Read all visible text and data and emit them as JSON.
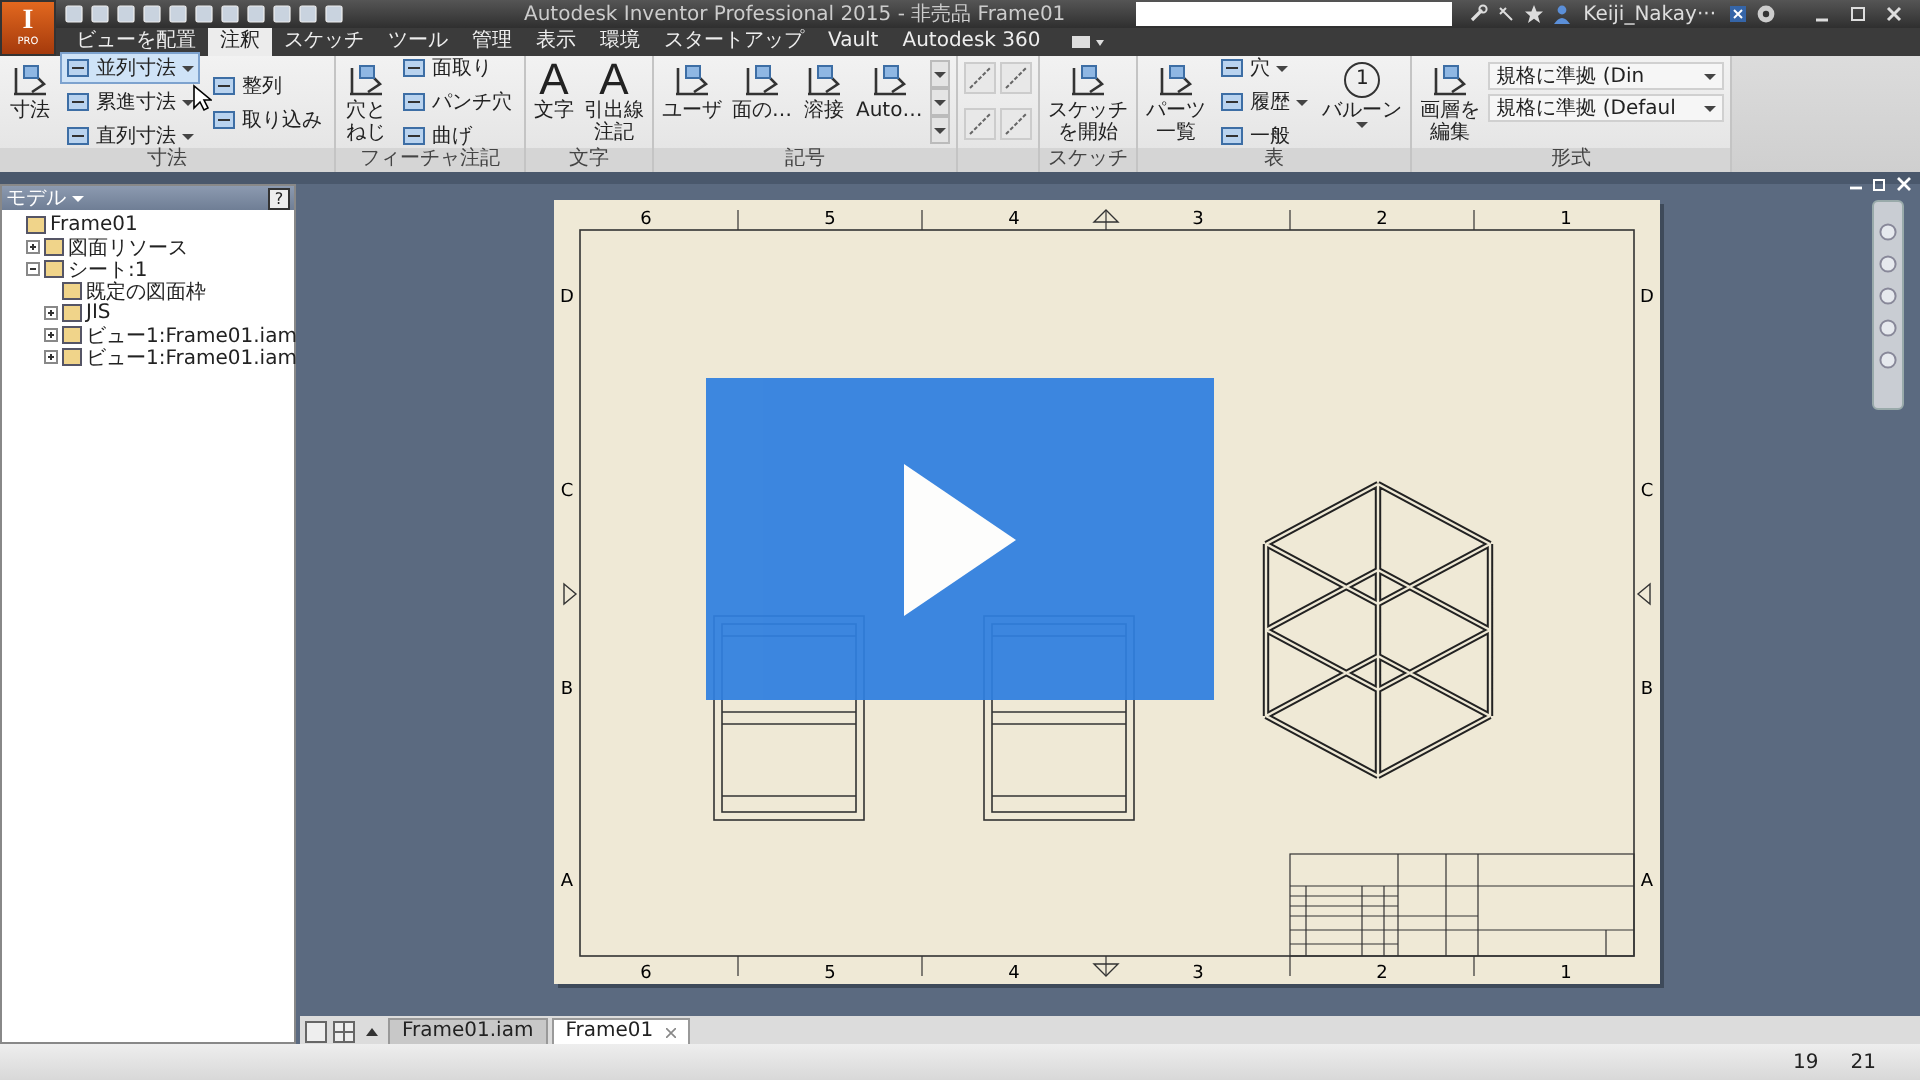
{
  "app_button": {
    "logo": "I",
    "label": "PRO"
  },
  "window": {
    "title": "Autodesk Inventor Professional 2015 - 非売品   Frame01"
  },
  "user": {
    "name": "Keiji_Nakay···"
  },
  "tabs": [
    {
      "label": "ビューを配置",
      "selected": false
    },
    {
      "label": "注釈",
      "selected": true
    },
    {
      "label": "スケッチ",
      "selected": false
    },
    {
      "label": "ツール",
      "selected": false
    },
    {
      "label": "管理",
      "selected": false
    },
    {
      "label": "表示",
      "selected": false
    },
    {
      "label": "環境",
      "selected": false
    },
    {
      "label": "スタートアップ",
      "selected": false
    },
    {
      "label": "Vault",
      "selected": false
    },
    {
      "label": "Autodesk 360",
      "selected": false
    }
  ],
  "ribbon": [
    {
      "title": "寸法",
      "columns": [
        {
          "kind": "large",
          "label": "寸法",
          "dropdown": false
        },
        {
          "kind": "stack",
          "items": [
            {
              "label": "並列寸法",
              "dropdown": true,
              "highlighted": true
            },
            {
              "label": "累進寸法",
              "dropdown": true,
              "highlighted": false
            },
            {
              "label": "直列寸法",
              "dropdown": true,
              "highlighted": false
            }
          ]
        },
        {
          "kind": "stack",
          "items": [
            {
              "label": "整列",
              "dropdown": false,
              "highlighted": false
            },
            {
              "label": "取り込み",
              "dropdown": false,
              "highlighted": false
            }
          ]
        }
      ]
    },
    {
      "title": "フィーチャ注記",
      "columns": [
        {
          "kind": "tall",
          "label": "穴とねじ",
          "dropdown": false
        },
        {
          "kind": "stack",
          "items": [
            {
              "label": "面取り",
              "dropdown": false,
              "highlighted": false
            },
            {
              "label": "パンチ穴",
              "dropdown": false,
              "highlighted": false
            },
            {
              "label": "曲げ",
              "dropdown": false,
              "highlighted": false
            }
          ]
        }
      ]
    },
    {
      "title": "文字",
      "columns": [
        {
          "kind": "large",
          "label": "文字",
          "glyph": "A",
          "dropdown": false
        },
        {
          "kind": "tall",
          "label": "引出線注記",
          "glyph": "A",
          "dropdown": false
        }
      ]
    },
    {
      "title": "記号",
      "columns": [
        {
          "kind": "large",
          "label": "ユーザ",
          "dropdown": false
        },
        {
          "kind": "large",
          "label": "面の…",
          "dropdown": false
        },
        {
          "kind": "large",
          "label": "溶接",
          "dropdown": false
        },
        {
          "kind": "large",
          "label": "Auto…",
          "dropdown": false
        },
        {
          "kind": "gallery_scroll"
        }
      ]
    },
    {
      "columns": [
        {
          "kind": "icon_grid"
        }
      ]
    },
    {
      "title": "スケッチ",
      "columns": [
        {
          "kind": "tall",
          "label": "スケッチを開始",
          "dropdown": false
        }
      ]
    },
    {
      "title": "表",
      "columns": [
        {
          "kind": "tall",
          "label": "パーツ一覧",
          "dropdown": false
        },
        {
          "kind": "stack",
          "items": [
            {
              "label": "穴",
              "dropdown": true,
              "highlighted": false
            },
            {
              "label": "履歴",
              "dropdown": true,
              "highlighted": false
            },
            {
              "label": "一般",
              "dropdown": false,
              "highlighted": false
            }
          ]
        },
        {
          "kind": "large",
          "label": "バルーン",
          "glyph": "1",
          "dropdown": true
        }
      ]
    },
    {
      "title": "形式",
      "columns": [
        {
          "kind": "tall",
          "label": "画層を編集",
          "dropdown": false
        },
        {
          "kind": "combo_stack",
          "fields": [
            {
              "value": "規格に準拠 (Din"
            },
            {
              "value": "規格に準拠 (Defaul"
            }
          ]
        }
      ]
    }
  ],
  "browser": {
    "title": "モデル",
    "help": "?",
    "tree": [
      {
        "label": "Frame01",
        "children": [
          {
            "label": "図面リソース",
            "expanded": false
          },
          {
            "label": "シート:1",
            "expanded": true,
            "children": [
              {
                "label": "既定の図面枠"
              },
              {
                "label": "JIS",
                "expanded": false
              },
              {
                "label": "ビュー1:Frame01.iam",
                "expanded": false
              },
              {
                "label": "ビュー1:Frame01.iam",
                "expanded": false
              }
            ]
          }
        ]
      }
    ]
  },
  "sheet": {
    "top_zones": [
      "6",
      "5",
      "4",
      "3",
      "2",
      "1"
    ],
    "bottom_zones": [
      "6",
      "5",
      "4",
      "3",
      "2",
      "1"
    ],
    "left_zones": [
      "D",
      "C",
      "B",
      "A"
    ],
    "right_zones": [
      "D",
      "C",
      "B",
      "A"
    ]
  },
  "document_tabs": [
    {
      "label": "Frame01.iam",
      "selected": false
    },
    {
      "label": "Frame01",
      "selected": true
    }
  ],
  "status_bar": {
    "values": [
      "19",
      "21"
    ]
  }
}
